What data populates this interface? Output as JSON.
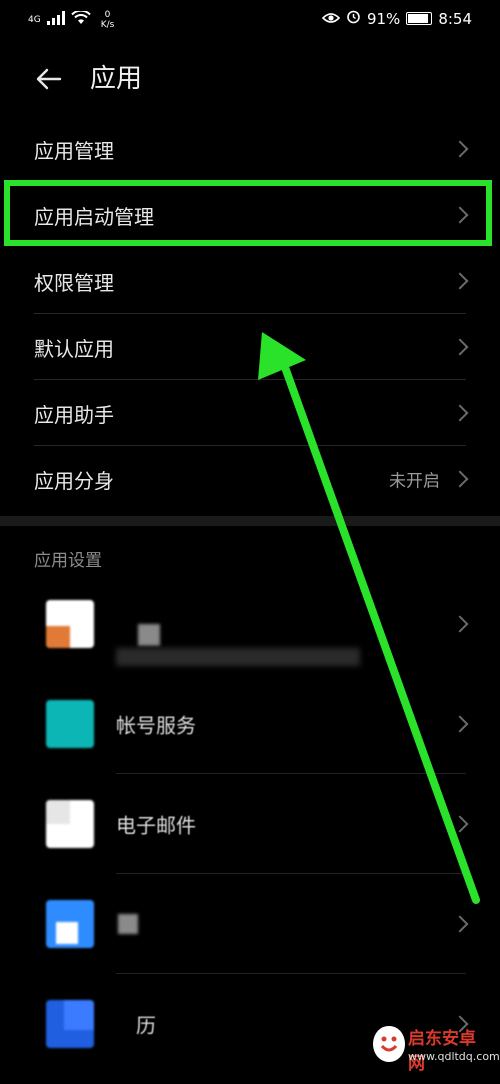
{
  "status_bar": {
    "signal_label": "4G",
    "net_speed_value": "0",
    "net_speed_unit": "K/s",
    "battery_percent": "91%",
    "time": "8:54"
  },
  "header": {
    "title": "应用"
  },
  "menu": {
    "items": [
      {
        "label": "应用管理",
        "value": ""
      },
      {
        "label": "应用启动管理",
        "value": ""
      },
      {
        "label": "权限管理",
        "value": ""
      },
      {
        "label": "默认应用",
        "value": ""
      },
      {
        "label": "应用助手",
        "value": ""
      },
      {
        "label": "应用分身",
        "value": "未开启"
      }
    ]
  },
  "settings": {
    "section_title": "应用设置",
    "apps": [
      {
        "name": "",
        "icon_colors": [
          "#ffffff",
          "#e07a36"
        ]
      },
      {
        "name": "帐号服务",
        "icon_colors": [
          "#0cb6b5",
          "#0cb6b5"
        ]
      },
      {
        "name": "电子邮件",
        "icon_colors": [
          "#ffffff",
          "#e6e6e6"
        ]
      },
      {
        "name": "",
        "icon_colors": [
          "#2f8cff",
          "#ffffff"
        ]
      },
      {
        "name": "历",
        "icon_colors": [
          "#1f5fe0",
          "#3b7bff"
        ]
      }
    ]
  },
  "annotation": {
    "highlight_color": "#2be22b"
  },
  "watermark": {
    "brand": "启东安卓网",
    "url": "www.qdltdq.com"
  }
}
